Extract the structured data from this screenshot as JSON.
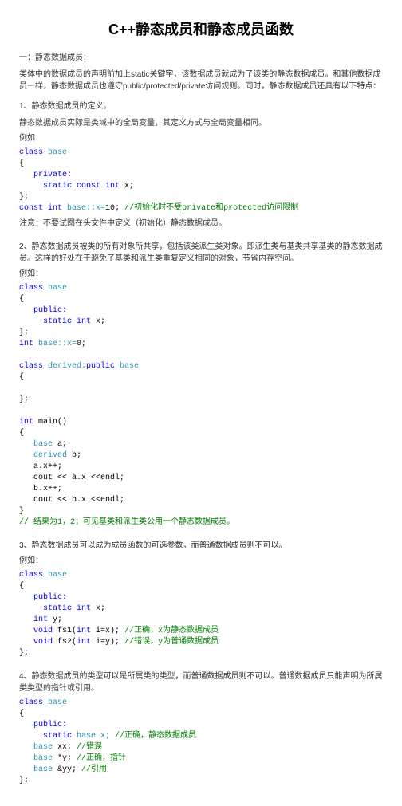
{
  "title": "C++静态成员和静态成员函数",
  "s1_head": "一：静态数据成员：",
  "s1_p1": "类体中的数据成员的声明前加上static关键字，该数据成员就成为了该类的静态数据成员。和其他数据成员一样，静态数据成员也遵守public/protected/private访问规则。同时，静态数据成员还具有以下特点：",
  "s1_t1_head": "1、静态数据成员的定义。",
  "s1_t1_p1": "静态数据成员实际是类域中的全局变量，其定义方式与全局变量相同。",
  "ex_label": "例如：",
  "note1": "注意：不要试图在头文件中定义（初始化）静态数据成员。",
  "s1_t2_head": "2、静态数据成员被类的所有对象所共享，包括该类派生类对象。即派生类与基类共享基类的静态数据成员。这样的好处在于避免了基类和派生类重复定义相同的对象，节省内存空间。",
  "res_label": "// 结果为1，2；可见基类和派生类公用一个静态数据成员。",
  "s1_t3_head": "3、静态数据成员可以成为成员函数的可选参数，而普通数据成员则不可以。",
  "s1_t4_head": "4、静态数据成员的类型可以是所属类的类型，而普通数据成员则不可以。普通数据成员只能声明为所属类类型的指针或引用。",
  "code1": {
    "l1a": "class",
    "l1b": " base",
    "l2": "{",
    "l3": "   private:",
    "l4a": "     static",
    "l4b": " const",
    "l4c": " int",
    "l4d": " x;",
    "l5": "};",
    "l6a": "const",
    "l6b": " int",
    "l6c": " base::x=",
    "l6d": "10",
    "l6e": "; ",
    "l6f": "//初始化时不受private和protected访问限制"
  },
  "code2": {
    "l1a": "class",
    "l1b": " base",
    "l2": "{",
    "l3": "   public:",
    "l4a": "     static",
    "l4b": " int",
    "l4c": " x;",
    "l5": "};",
    "l6a": "int",
    "l6b": " base::x=",
    "l6c": "0",
    "l6d": ";",
    "l8a": "class",
    "l8b": " derived:",
    "l8c": "public",
    "l8d": " base",
    "l9": "{",
    "l11": "};",
    "l13a": "int",
    "l13b": " main()",
    "l14": "{",
    "l15a": "   base",
    "l15b": " a;",
    "l16a": "   derived",
    "l16b": " b;",
    "l17": "   a.x++;",
    "l18": "   cout << a.x <<endl;",
    "l19": "   b.x++;",
    "l20": "   cout << b.x <<endl;",
    "l21": "}"
  },
  "code3": {
    "l1a": "class",
    "l1b": " base",
    "l2": "{",
    "l3": "   public:",
    "l4a": "     static",
    "l4b": " int",
    "l4c": " x;",
    "l5a": "   int",
    "l5b": " y;",
    "l6a": "   void",
    "l6b": " fs1(",
    "l6c": "int",
    "l6d": " i=x); ",
    "l6e": "//正确，x为静态数据成员",
    "l7a": "   void",
    "l7b": " fs2(",
    "l7c": "int",
    "l7d": " i=y); ",
    "l7e": "//错误，y为普通数据成员",
    "l8": "};"
  },
  "code4": {
    "l1a": "class",
    "l1b": " base",
    "l2": "{",
    "l3": "   public:",
    "l4a": "     static",
    "l4b": " base x; ",
    "l4c": "//正确，静态数据成员",
    "l5a": "   base",
    "l5b": " xx; ",
    "l5c": "//错误",
    "l6a": "   base",
    "l6b": " *y; ",
    "l6c": "//正确，指针",
    "l7a": "   base",
    "l7b": " &yy; ",
    "l7c": "//引用",
    "l8": "};"
  }
}
